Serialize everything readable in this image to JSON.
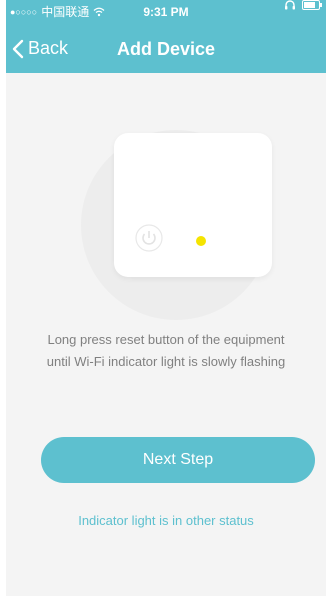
{
  "status_bar": {
    "carrier": "中国联通",
    "time": "9:31 PM"
  },
  "header": {
    "back_label": "Back",
    "title": "Add Device"
  },
  "instructions": {
    "line1": "Long press reset button of the equipment",
    "line2": "until Wi-Fi indicator light is slowly flashing"
  },
  "actions": {
    "next_label": "Next Step",
    "other_status_label": "Indicator light is in other status"
  },
  "colors": {
    "accent": "#5dc0cf",
    "indicator": "#f5e400"
  },
  "icons": {
    "back": "chevron-left-icon",
    "power": "power-icon"
  }
}
